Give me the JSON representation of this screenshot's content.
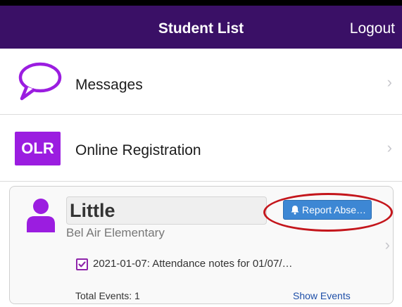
{
  "header": {
    "title": "Student List",
    "logout_label": "Logout"
  },
  "menu": [
    {
      "label": "Messages",
      "icon": "speech-bubble-icon",
      "chevron": "›"
    },
    {
      "label": "Online Registration",
      "icon_text": "OLR",
      "chevron": "›"
    }
  ],
  "student": {
    "name": "Little",
    "school": "Bel Air Elementary",
    "report_button": "Report Abse…",
    "note": "2021-01-07: Attendance notes for 01/07/…",
    "total_events": "Total Events: 1",
    "show_events": "Show Events",
    "chevron": "›"
  },
  "colors": {
    "header_bg": "#3a1066",
    "accent_purple": "#9b1de0",
    "button_blue": "#3d87d4",
    "highlight_red": "#c4161c"
  }
}
